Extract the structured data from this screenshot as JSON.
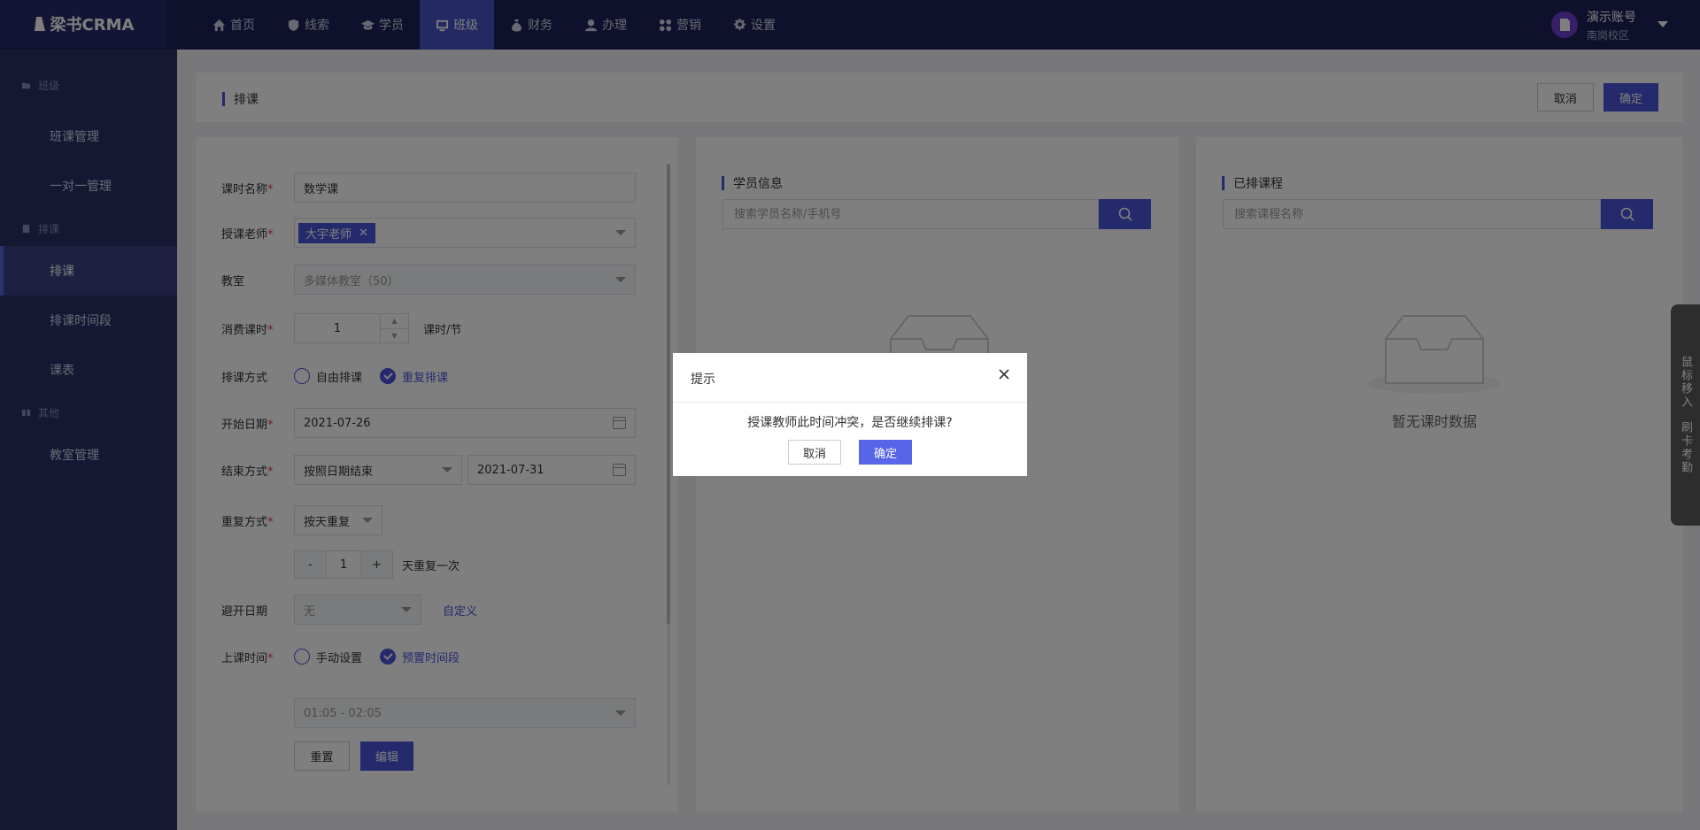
{
  "brand": {
    "logo_text": "梁书CRMA"
  },
  "topnav": [
    {
      "label": "首页",
      "icon": "home-icon"
    },
    {
      "label": "线索",
      "icon": "shield-icon"
    },
    {
      "label": "学员",
      "icon": "graduation-cap-icon"
    },
    {
      "label": "班级",
      "icon": "classroom-icon"
    },
    {
      "label": "财务",
      "icon": "money-bag-icon"
    },
    {
      "label": "办理",
      "icon": "user-icon"
    },
    {
      "label": "营销",
      "icon": "marketing-icon"
    },
    {
      "label": "设置",
      "icon": "gear-icon"
    }
  ],
  "topnav_active": "班级",
  "user": {
    "name": "演示账号",
    "campus": "南岗校区"
  },
  "sidebar": {
    "groups": [
      {
        "label": "班级",
        "items": [
          "班课管理",
          "一对一管理"
        ]
      },
      {
        "label": "排课",
        "items": [
          "排课",
          "排课时间段",
          "课表"
        ]
      },
      {
        "label": "其他",
        "items": [
          "教室管理"
        ]
      }
    ],
    "active": "排课"
  },
  "header": {
    "title": "排课",
    "cancel_label": "取消",
    "ok_label": "确定"
  },
  "form": {
    "course_name_label": "课时名称",
    "course_name_value": "数学课",
    "teacher_label": "授课老师",
    "teacher_tag": "大宇老师",
    "classroom_label": "教室",
    "classroom_value": "多媒体教室（50）",
    "hours_label": "消费课时",
    "hours_value": "1",
    "hours_unit": "课时/节",
    "mode_label": "排课方式",
    "mode_free": "自由排课",
    "mode_repeat": "重复排课",
    "start_label": "开始日期",
    "start_value": "2021-07-26",
    "end_label": "结束方式",
    "end_mode_value": "按照日期结束",
    "end_date_value": "2021-07-31",
    "repeat_label": "重复方式",
    "repeat_value": "按天重复",
    "repeat_minus": "-",
    "repeat_count": "1",
    "repeat_plus": "+",
    "repeat_unit": "天重复一次",
    "avoid_label": "避开日期",
    "avoid_value": "无",
    "avoid_custom": "自定义",
    "time_label": "上课时间",
    "time_manual": "手动设置",
    "time_preset": "预置时间段",
    "time_slot_value": "01:05 - 02:05",
    "reset_label": "重置",
    "edit_label": "编辑"
  },
  "students": {
    "title": "学员信息",
    "search_placeholder": "搜索学员名称/手机号"
  },
  "scheduled": {
    "title": "已排课程",
    "search_placeholder": "搜索课程名称",
    "empty_text": "暂无课时数据"
  },
  "float_tab": {
    "line1": "鼠标移入",
    "line2": "刷卡考勤"
  },
  "dialog": {
    "title": "提示",
    "message": "授课教师此时间冲突，是否继续排课?",
    "cancel_label": "取消",
    "ok_label": "确定"
  },
  "colors": {
    "primary": "#4a55d8",
    "topbar": "#1e2358",
    "sidebar": "#2a3066"
  }
}
